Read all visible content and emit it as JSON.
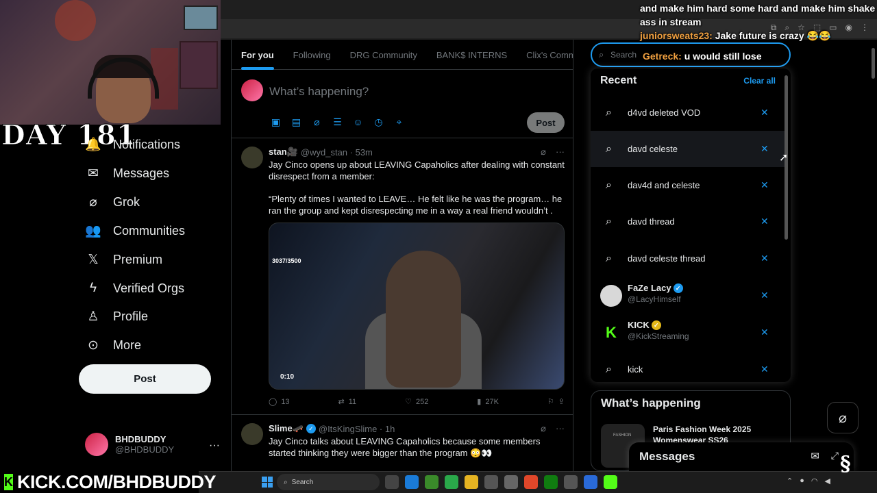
{
  "overlay": {
    "day_label": "DAY 181",
    "kick_url": "KICK.COM/BHDBUDDY",
    "chat": {
      "line1": "and make him hard some hard and make him shake ass in stream",
      "line2_user": "juniorsweats23:",
      "line2_text": "Jake future is crazy 😂😂",
      "line3_user": "Getreck:",
      "line3_text": "u would still lose"
    }
  },
  "nav": {
    "items": [
      {
        "label": "Notifications",
        "icon": "bell-icon"
      },
      {
        "label": "Messages",
        "icon": "mail-icon"
      },
      {
        "label": "Grok",
        "icon": "grok-icon"
      },
      {
        "label": "Communities",
        "icon": "communities-icon"
      },
      {
        "label": "Premium",
        "icon": "x-logo-icon"
      },
      {
        "label": "Verified Orgs",
        "icon": "lightning-icon"
      },
      {
        "label": "Profile",
        "icon": "person-icon"
      },
      {
        "label": "More",
        "icon": "more-circle-icon"
      }
    ],
    "post_label": "Post",
    "account": {
      "name": "BHDBUDDY",
      "handle": "@BHDBUDDY",
      "more": "···"
    }
  },
  "main": {
    "tabs": [
      "For you",
      "Following",
      "DRG Community",
      "BANK$ INTERNS",
      "Clix's Commu"
    ],
    "compose": {
      "placeholder": "What’s happening?",
      "post_label": "Post"
    },
    "tweets": [
      {
        "name": "stan🎥",
        "handle": "@wyd_stan · 53m",
        "text1": "Jay Cinco opens up about LEAVING Capaholics after dealing with constant disrespect from a member:",
        "text2": "“Plenty of times I wanted to LEAVE… He felt like he was the program… he ran the group and kept disrespecting me in a way a real friend wouldn’t .",
        "media_label": "3037/3500",
        "duration": "0:10",
        "replies": "13",
        "reposts": "11",
        "likes": "252",
        "views": "27K"
      },
      {
        "name": "Slime🛹",
        "handle": "@ItsKingSlime · 1h",
        "text1": "Jay Cinco talks about LEAVING Capaholics because some members started thinking they were bigger than the program 😳👀"
      }
    ]
  },
  "search": {
    "placeholder": "Search",
    "recent_title": "Recent",
    "clear_all": "Clear all",
    "recent_queries": [
      "d4vd deleted VOD",
      "davd celeste",
      "dav4d and celeste",
      "davd thread",
      "davd celeste thread"
    ],
    "recent_users": [
      {
        "name": "FaZe Lacy",
        "handle": "@LacyHimself",
        "badge": "blue"
      },
      {
        "name": "KICK",
        "handle": "@KickStreaming",
        "badge": "gold"
      }
    ],
    "last_query": "kick"
  },
  "whats_happening": {
    "title": "What’s happening",
    "item": "Paris Fashion Week 2025 Womenswear SS26",
    "thumb_label": "FASHION"
  },
  "messages_dock": {
    "title": "Messages"
  },
  "taskbar": {
    "search": "Search"
  }
}
